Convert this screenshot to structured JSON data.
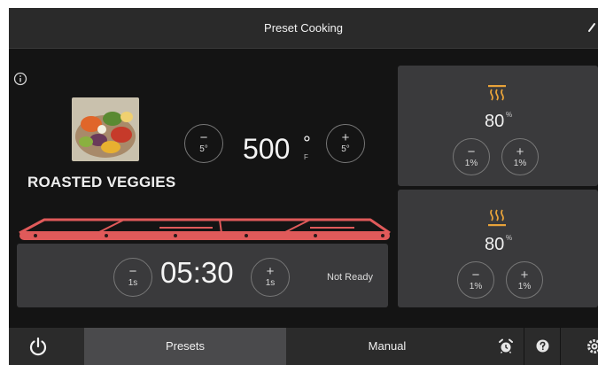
{
  "header": {
    "title": "Preset Cooking"
  },
  "recipe": {
    "name": "ROASTED VEGGIES"
  },
  "temperature": {
    "value": "500",
    "degree": "°",
    "unit": "F",
    "decrease_step": "5°",
    "increase_step": "5°",
    "minus": "−",
    "plus": "+"
  },
  "timer": {
    "value": "05:30",
    "decrease_step": "1s",
    "increase_step": "1s",
    "status": "Not Ready",
    "minus": "−",
    "plus": "+"
  },
  "top_heat": {
    "value": "80",
    "unit": "%",
    "decrease_step": "1%",
    "increase_step": "1%",
    "minus": "−",
    "plus": "+",
    "icon": "top-heater-icon"
  },
  "bottom_heat": {
    "value": "80",
    "unit": "%",
    "decrease_step": "1%",
    "increase_step": "1%",
    "minus": "−",
    "plus": "+",
    "icon": "bottom-heater-icon"
  },
  "nav": {
    "presets": "Presets",
    "manual": "Manual",
    "icons": [
      "power-icon",
      "timer-alarm-icon",
      "help-icon",
      "settings-icon"
    ]
  },
  "colors": {
    "accent_orange": "#e8a33a",
    "oven_red": "#e05a5a",
    "panel": "#3a3a3c",
    "background": "#141414"
  }
}
